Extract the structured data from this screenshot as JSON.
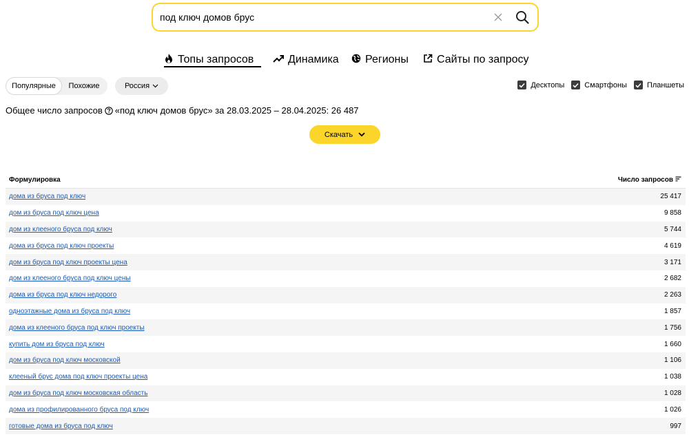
{
  "search": {
    "value": "под ключ домов брус"
  },
  "tabs": [
    {
      "label": "Топы запросов",
      "icon": "fire-icon"
    },
    {
      "label": "Динамика",
      "icon": "trend-up-icon"
    },
    {
      "label": "Регионы",
      "icon": "globe-icon"
    },
    {
      "label": "Сайты по запросу",
      "icon": "external-link-icon"
    }
  ],
  "filters": {
    "mode_options": [
      "Популярные",
      "Похожие"
    ],
    "region": "Россия",
    "devices": [
      "Десктопы",
      "Смартфоны",
      "Планшеты"
    ]
  },
  "summary": {
    "prefix": "Общее число запросов",
    "text": "«под ключ домов брус» за 28.03.2025 – 28.04.2025: 26 487"
  },
  "download_label": "Скачать",
  "table": {
    "col_phrase": "Формулировка",
    "col_count": "Число запросов",
    "rows": [
      {
        "phrase": "дома из бруса под ключ",
        "count": "25 417"
      },
      {
        "phrase": "дом из бруса под ключ цена",
        "count": "9 858"
      },
      {
        "phrase": "дом из клееного бруса под ключ",
        "count": "5 744"
      },
      {
        "phrase": "дома из бруса под ключ проекты",
        "count": "4 619"
      },
      {
        "phrase": "дом из бруса под ключ проекты цена",
        "count": "3 171"
      },
      {
        "phrase": "дом из клееного бруса под ключ цены",
        "count": "2 682"
      },
      {
        "phrase": "дома из бруса под ключ недорого",
        "count": "2 263"
      },
      {
        "phrase": "одноэтажные дома из бруса под ключ",
        "count": "1 857"
      },
      {
        "phrase": "дома из клееного бруса под ключ проекты",
        "count": "1 756"
      },
      {
        "phrase": "купить дом из бруса под ключ",
        "count": "1 660"
      },
      {
        "phrase": "дом из бруса под ключ московской",
        "count": "1 106"
      },
      {
        "phrase": "клееный брус дома под ключ проекты цена",
        "count": "1 038"
      },
      {
        "phrase": "дом из бруса под ключ московская область",
        "count": "1 028"
      },
      {
        "phrase": "дома из профилированного бруса под ключ",
        "count": "1 026"
      },
      {
        "phrase": "готовые дома из бруса под ключ",
        "count": "997"
      }
    ]
  }
}
